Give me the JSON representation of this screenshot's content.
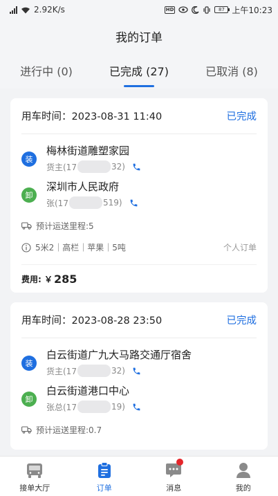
{
  "statusbar": {
    "speed": "2.92K/s",
    "battery": "87",
    "time": "上午10:23"
  },
  "header": {
    "title": "我的订单"
  },
  "tabs": [
    {
      "label": "进行中 (0)"
    },
    {
      "label": "已完成 (27)"
    },
    {
      "label": "已取消 (8)"
    }
  ],
  "orders": [
    {
      "time_label": "用车时间：",
      "time": "2023-08-31 11:40",
      "status": "已完成",
      "load": {
        "badge": "装",
        "address": "梅林街道雕塑家园",
        "name": "货主(17",
        "tail": "32)"
      },
      "unload": {
        "badge": "卸",
        "address": "深圳市人民政府",
        "name": "张(17",
        "tail": "519)"
      },
      "distance": "预计运送里程:5",
      "specs": "5米2｜高栏｜苹果｜5吨",
      "kind": "个人订单",
      "fee_label": "费用: ￥",
      "fee": "285"
    },
    {
      "time_label": "用车时间：",
      "time": "2023-08-28 23:50",
      "status": "已完成",
      "load": {
        "badge": "装",
        "address": "白云街道广九大马路交通厅宿舍",
        "name": "货主(17",
        "tail": "32)"
      },
      "unload": {
        "badge": "卸",
        "address": "白云街道港口中心",
        "name": "张总(17",
        "tail": "19)"
      },
      "distance": "预计运送里程:0.7"
    }
  ],
  "nav": [
    {
      "label": "接单大厅"
    },
    {
      "label": "订单"
    },
    {
      "label": "消息"
    },
    {
      "label": "我的"
    }
  ],
  "colors": {
    "accent": "#1f6fe0",
    "unload": "#4caf50",
    "badge_dot": "#e5262b"
  }
}
